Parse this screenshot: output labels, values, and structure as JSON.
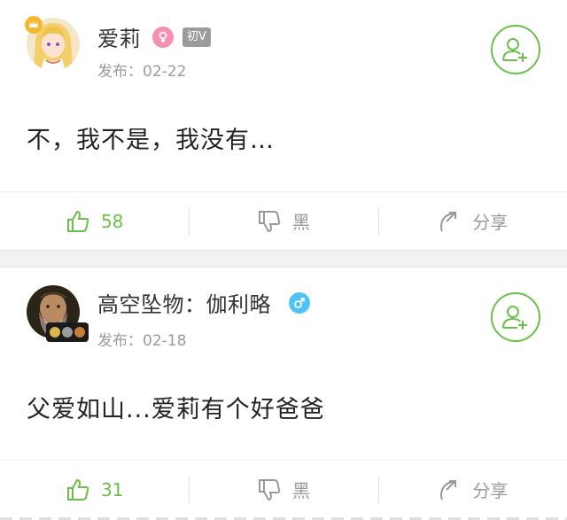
{
  "posts": [
    {
      "username": "爱莉",
      "gender": "female",
      "gender_color": "#f48fb1",
      "level": "初V",
      "date_label": "发布：",
      "date": "02-22",
      "content": "不，我不是，我没有…",
      "likes": "58",
      "dislike_label": "黑",
      "share_label": "分享",
      "avatar_icon": "anime-girl-avatar"
    },
    {
      "username": "高空坠物：伽利略",
      "gender": "male",
      "gender_color": "#4fc3f7",
      "date_label": "发布：",
      "date": "02-18",
      "content": "父爱如山...爱莉有个好爸爸",
      "likes": "31",
      "dislike_label": "黑",
      "share_label": "分享",
      "avatar_icon": "galileo-portrait-avatar"
    }
  ],
  "colors": {
    "accent": "#6abf4b",
    "muted": "#9b9b9b",
    "separator": "#f2f2f2"
  }
}
